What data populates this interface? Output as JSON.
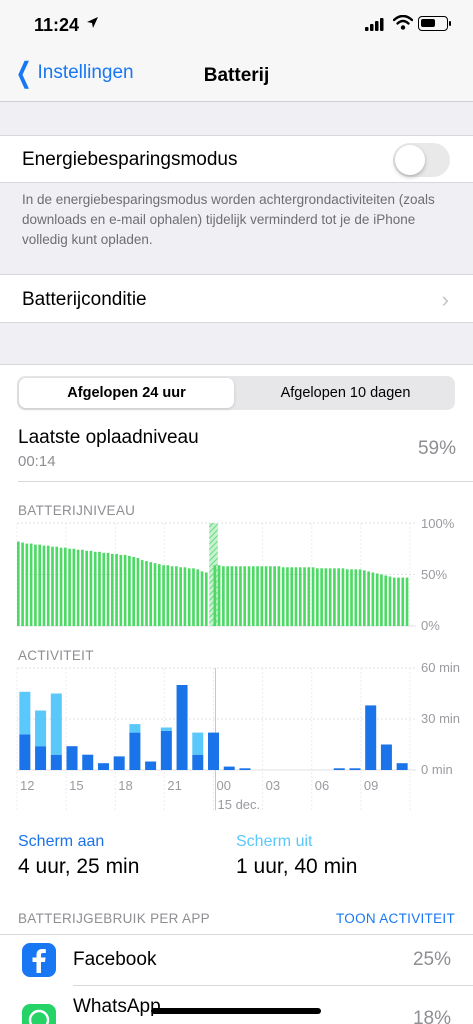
{
  "status_bar": {
    "time": "11:24",
    "location_icon": "location-arrow-icon",
    "battery_level": 0.59
  },
  "nav": {
    "back_label": "Instellingen",
    "title": "Batterij"
  },
  "low_power": {
    "label": "Energiebesparingsmodus",
    "enabled": false,
    "note": "In de energiebesparingsmodus worden achtergrondactiviteiten (zoals downloads en e-mail ophalen) tijdelijk verminderd tot je de iPhone volledig kunt opladen."
  },
  "battery_health": {
    "label": "Batterijconditie"
  },
  "segment": {
    "options": [
      "Afgelopen 24 uur",
      "Afgelopen 10 dagen"
    ],
    "selected": 0
  },
  "last_charge": {
    "label": "Laatste oplaadniveau",
    "time": "00:14",
    "value": "59%"
  },
  "colors": {
    "accent": "#1877f2",
    "battery_green": "#4cd964",
    "screen_on": "#1a73e8",
    "screen_off": "#5ac8fa"
  },
  "chart_data": [
    {
      "type": "bar",
      "title": "BATTERIJNIVEAU",
      "y_ticks": [
        "100%",
        "50%",
        "0%"
      ],
      "ylim": [
        0,
        100
      ],
      "unit": "%",
      "values": [
        82,
        81,
        80,
        80,
        79,
        79,
        78,
        78,
        77,
        77,
        76,
        76,
        75,
        75,
        74,
        74,
        73,
        73,
        72,
        72,
        71,
        71,
        70,
        70,
        69,
        69,
        68,
        67,
        66,
        64,
        63,
        62,
        61,
        60,
        59,
        59,
        58,
        58,
        57,
        57,
        56,
        56,
        55,
        53,
        52,
        100,
        59,
        59,
        58,
        58,
        58,
        58,
        58,
        58,
        58,
        58,
        58,
        58,
        58,
        58,
        58,
        58,
        57,
        57,
        57,
        57,
        57,
        57,
        57,
        57,
        56,
        56,
        56,
        56,
        56,
        56,
        56,
        55,
        55,
        55,
        55,
        54,
        53,
        52,
        51,
        50,
        49,
        48,
        47,
        47,
        47,
        47
      ],
      "charging_index": 45
    },
    {
      "type": "bar",
      "title": "ACTIVITEIT",
      "y_ticks": [
        "60 min",
        "30 min",
        "0 min"
      ],
      "ylim": [
        0,
        60
      ],
      "x_ticks": [
        "12",
        "15",
        "18",
        "21",
        "00",
        "03",
        "06",
        "09"
      ],
      "x_sublabel": "15 dec.",
      "series": [
        {
          "name": "Scherm aan",
          "values": [
            21,
            14,
            9,
            14,
            9,
            4,
            8,
            22,
            5,
            23,
            50,
            9,
            22,
            2,
            1,
            0,
            0,
            0,
            0,
            0,
            1,
            1,
            38,
            15,
            4
          ]
        },
        {
          "name": "Scherm uit",
          "values": [
            25,
            21,
            36,
            0,
            0,
            0,
            0,
            5,
            0,
            2,
            0,
            13,
            0,
            0,
            0,
            0,
            0,
            0,
            0,
            0,
            0,
            0,
            0,
            0,
            0
          ]
        }
      ]
    }
  ],
  "summary": {
    "screen_on_label": "Scherm aan",
    "screen_on_value": "4 uur, 25 min",
    "screen_off_label": "Scherm uit",
    "screen_off_value": "1 uur, 40 min"
  },
  "usage": {
    "header": "BATTERIJGEBRUIK PER APP",
    "action": "TOON ACTIVITEIT",
    "apps": [
      {
        "name": "Facebook",
        "value": "25%",
        "icon": "facebook-icon"
      },
      {
        "name": "WhatsApp",
        "value": "18%",
        "icon": "whatsapp-icon"
      }
    ]
  }
}
